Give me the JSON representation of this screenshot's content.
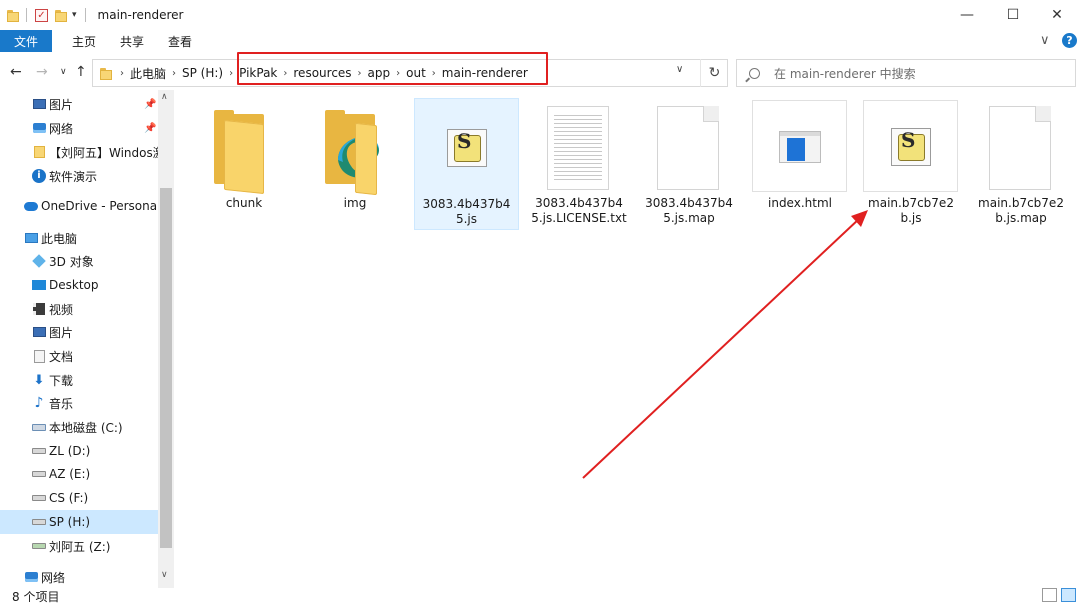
{
  "window": {
    "title": "main-renderer"
  },
  "ribbon": {
    "tabs": [
      "文件",
      "主页",
      "共享",
      "查看"
    ]
  },
  "address": {
    "crumbs": [
      "此电脑",
      "SP (H:)",
      "PikPak",
      "resources",
      "app",
      "out",
      "main-renderer"
    ],
    "search_placeholder": "在 main-renderer 中搜索"
  },
  "nav": {
    "items": [
      {
        "label": "图片",
        "icon": "pictures-icon",
        "pinned": true
      },
      {
        "label": "网络",
        "icon": "network-icon",
        "pinned": true
      },
      {
        "label": "【刘阿五】Windos激",
        "icon": "folder-icon"
      },
      {
        "label": "软件演示",
        "icon": "info-icon"
      },
      {
        "label": "OneDrive - Personal",
        "icon": "onedrive-icon"
      },
      {
        "label": "此电脑",
        "icon": "this-pc-icon"
      },
      {
        "label": "3D 对象",
        "icon": "3d-objects-icon"
      },
      {
        "label": "Desktop",
        "icon": "desktop-icon"
      },
      {
        "label": "视频",
        "icon": "videos-icon"
      },
      {
        "label": "图片",
        "icon": "pictures-icon"
      },
      {
        "label": "文档",
        "icon": "documents-icon"
      },
      {
        "label": "下载",
        "icon": "downloads-icon"
      },
      {
        "label": "音乐",
        "icon": "music-icon"
      },
      {
        "label": "本地磁盘 (C:)",
        "icon": "drive-c-icon"
      },
      {
        "label": "ZL (D:)",
        "icon": "drive-icon"
      },
      {
        "label": "AZ (E:)",
        "icon": "drive-icon"
      },
      {
        "label": "CS (F:)",
        "icon": "drive-icon"
      },
      {
        "label": "SP (H:)",
        "icon": "drive-icon",
        "selected": true
      },
      {
        "label": "刘阿五 (Z:)",
        "icon": "network-drive-icon"
      },
      {
        "label": "网络",
        "icon": "network-icon"
      }
    ]
  },
  "files": [
    {
      "name": "chunk",
      "type": "folder"
    },
    {
      "name": "img",
      "type": "folder-edge"
    },
    {
      "name": "3083.4b437b45.js",
      "type": "script",
      "selected": true
    },
    {
      "name": "3083.4b437b45.js.LICENSE.txt",
      "type": "text"
    },
    {
      "name": "3083.4b437b45.js.map",
      "type": "blank"
    },
    {
      "name": "index.html",
      "type": "html"
    },
    {
      "name": "main.b7cb7e2b.js",
      "type": "script"
    },
    {
      "name": "main.b7cb7e2b.js.map",
      "type": "blank"
    }
  ],
  "status": {
    "count": "8 个项目"
  },
  "colors": {
    "accent": "#1979ca",
    "highlight": "#e02020",
    "selection": "#cce8ff"
  }
}
